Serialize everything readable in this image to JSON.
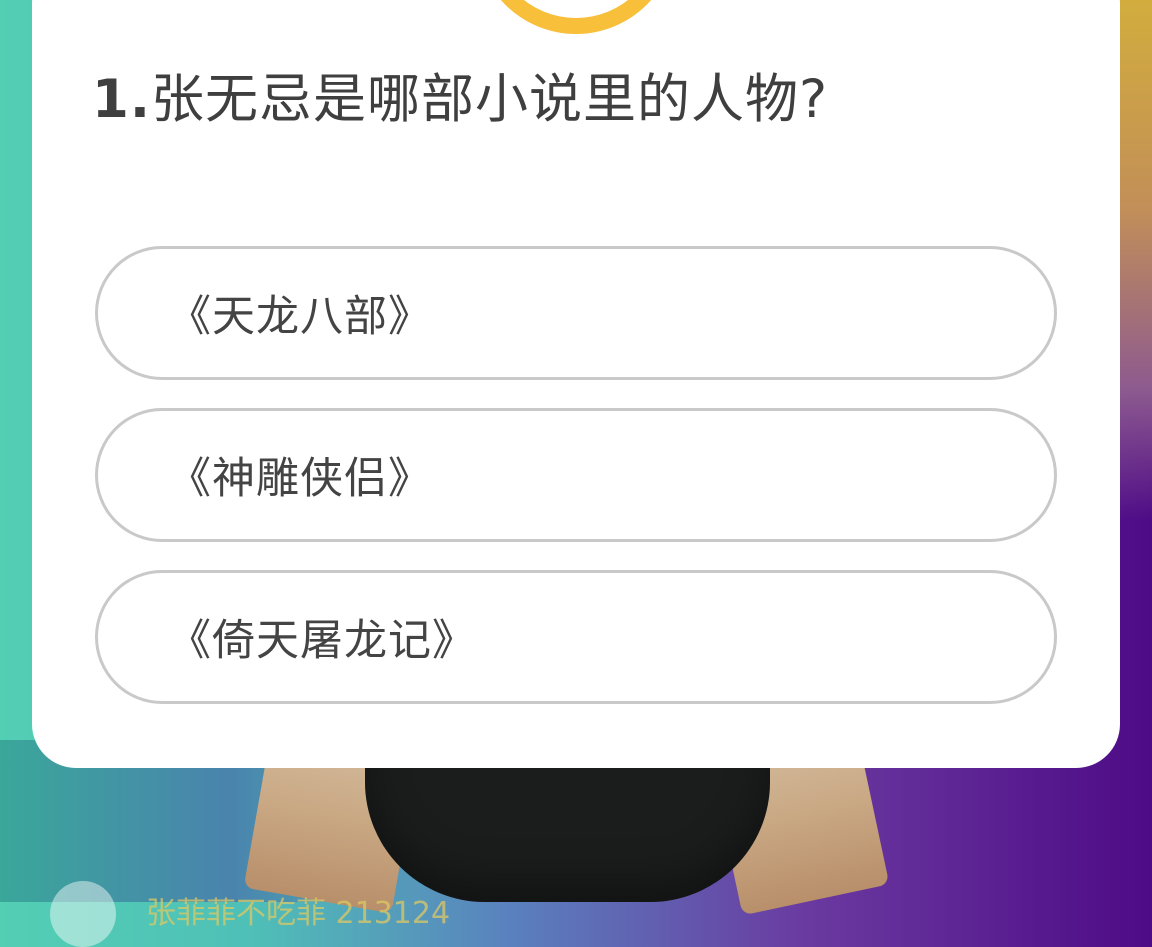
{
  "quiz": {
    "question_number": "1.",
    "question_text": "张无忌是哪部小说里的人物?",
    "options": [
      {
        "label": "《天龙八部》"
      },
      {
        "label": "《神雕侠侣》"
      },
      {
        "label": "《倚天屠龙记》"
      }
    ]
  },
  "footer": {
    "username": "张菲菲不吃菲 213124"
  },
  "colors": {
    "timer_ring": "#f7bf3a",
    "card_background": "#ffffff",
    "option_border": "#c9c9c9",
    "text": "#3f3f3f"
  },
  "icons": {
    "timer": "countdown-ring-icon",
    "avatar": "avatar"
  }
}
